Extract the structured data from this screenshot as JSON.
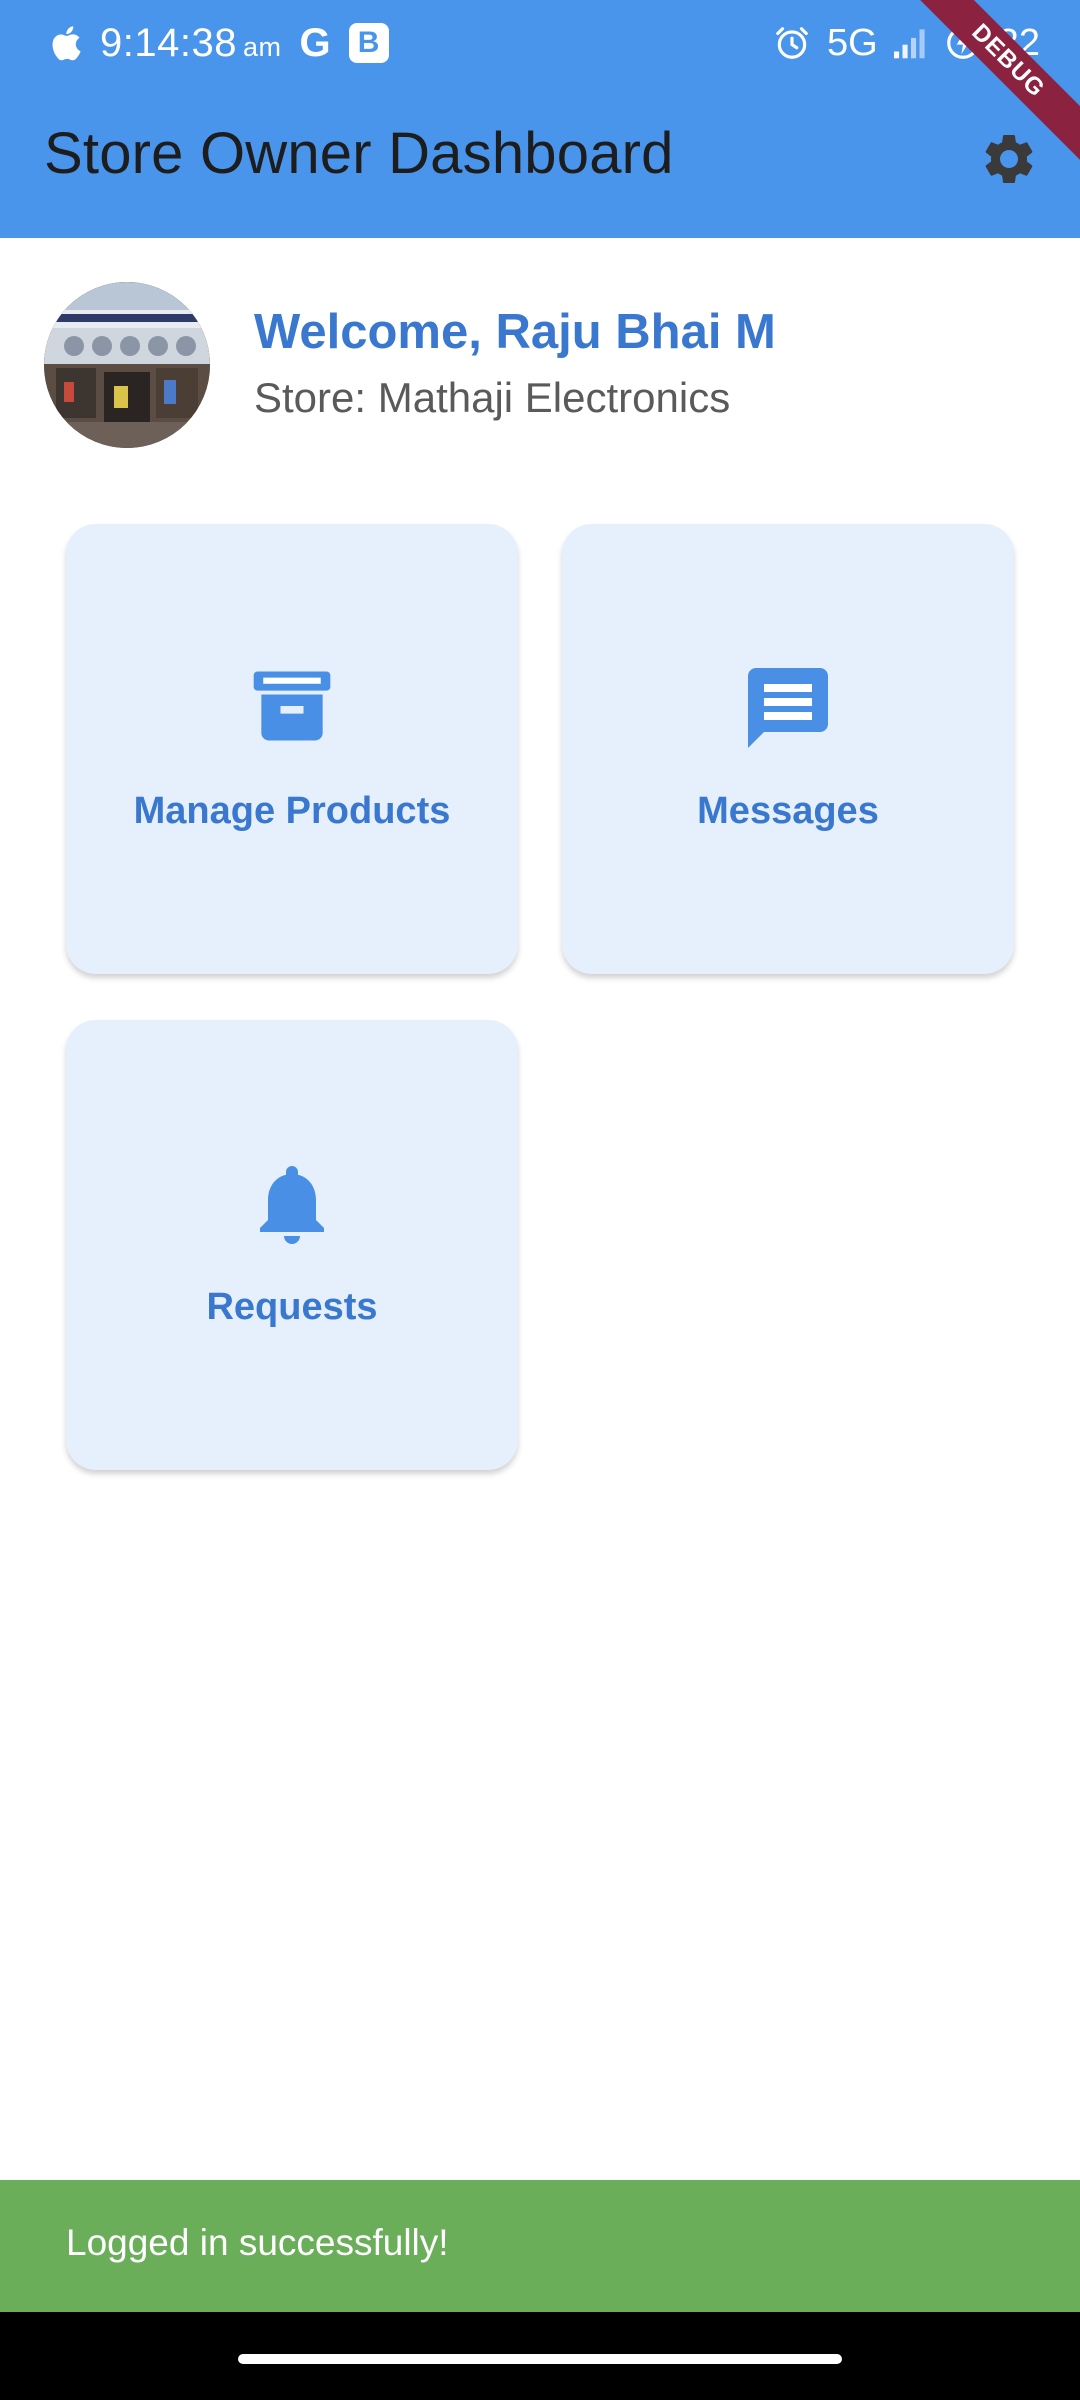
{
  "status_bar": {
    "time": "9:14:38",
    "ampm": "am",
    "g_badge": "G",
    "b_badge": "B",
    "network": "5G",
    "battery": "32"
  },
  "app_bar": {
    "title": "Store Owner Dashboard",
    "settings_icon": "gear-icon",
    "background_color": "#4a95ec"
  },
  "debug_banner": "DEBUG",
  "profile": {
    "welcome": "Welcome, Raju Bhai M",
    "store": "Store: Mathaji Electronics",
    "avatar_icon": "store-photo"
  },
  "tiles": [
    {
      "label": "Manage Products",
      "icon": "archive-icon"
    },
    {
      "label": "Messages",
      "icon": "message-icon"
    },
    {
      "label": "Requests",
      "icon": "bell-icon"
    }
  ],
  "snackbar": {
    "message": "Logged in successfully!",
    "color": "#6aae5a"
  },
  "colors": {
    "accent": "#3a78cf",
    "tile_bg": "#e5f0fc"
  }
}
